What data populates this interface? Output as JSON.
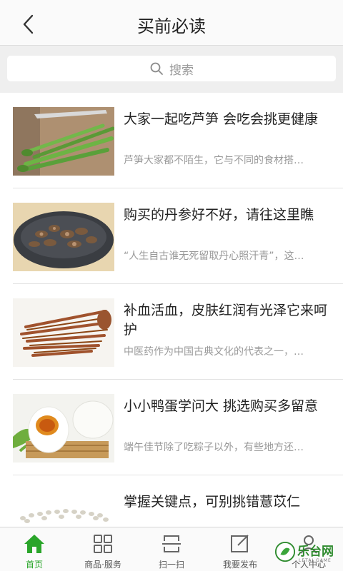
{
  "header": {
    "title": "买前必读"
  },
  "search": {
    "placeholder": "搜索"
  },
  "articles": [
    {
      "title": "大家一起吃芦笋 会吃会挑更健康",
      "desc": "芦笋大家都不陌生，它与不同的食材搭…"
    },
    {
      "title": "购买的丹参好不好，请往这里瞧",
      "desc": "“人生自古谁无死留取丹心照汗青”，这…"
    },
    {
      "title": "补血活血，皮肤红润有光泽它来呵护",
      "desc": "中医药作为中国古典文化的代表之一，…"
    },
    {
      "title": "小小鸭蛋学问大 挑选购买多留意",
      "desc": "端午佳节除了吃粽子以外，有些地方还…"
    },
    {
      "title": "掌握关键点，可别挑错薏苡仁",
      "desc": ""
    }
  ],
  "tabbar": {
    "items": [
      {
        "label": "首页",
        "icon": "home-icon",
        "active": true
      },
      {
        "label": "商品·服务",
        "icon": "grid-icon",
        "active": false
      },
      {
        "label": "扫一扫",
        "icon": "scan-icon",
        "active": false
      },
      {
        "label": "我要发布",
        "icon": "edit-icon",
        "active": false
      },
      {
        "label": "个人中心",
        "icon": "user-icon",
        "active": false
      }
    ]
  },
  "watermark": {
    "text": "乐台网",
    "sub": "LETAI GAME"
  },
  "colors": {
    "accent": "#2aa52a",
    "text": "#222222",
    "muted": "#999999"
  }
}
